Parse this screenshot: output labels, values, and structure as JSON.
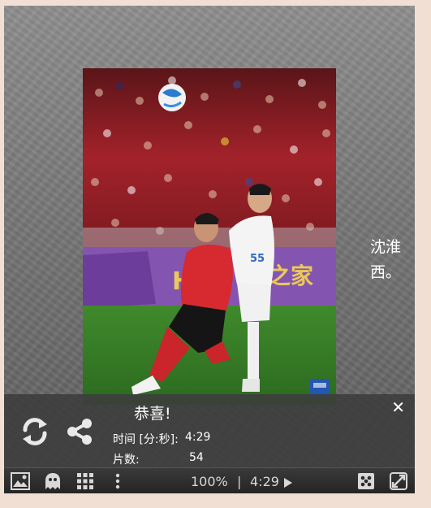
{
  "side_text": {
    "line1": "沈淮",
    "line2": "西。"
  },
  "result_panel": {
    "title": "恭喜!",
    "close_label": "✕",
    "time_label": "时间 [分:秒]:",
    "time_value": "4:29",
    "pieces_label": "片数:",
    "pieces_value": "54"
  },
  "toolbar": {
    "zoom": "100%",
    "separator": "|",
    "timer": "4:29"
  },
  "icons": {
    "replay": "replay-icon",
    "share": "share-icon",
    "image": "image-icon",
    "ghost": "ghost-icon",
    "grid": "grid-icon",
    "more": "more-vertical-icon",
    "play": "play-icon",
    "shuffle": "puzzle-icon",
    "fullscreen": "fullscreen-icon"
  },
  "colors": {
    "panel_bg": "#3c3c3c",
    "text": "#ffffff",
    "frame_bg": "#7a7a7a",
    "page_bg": "#f2dfd4"
  }
}
